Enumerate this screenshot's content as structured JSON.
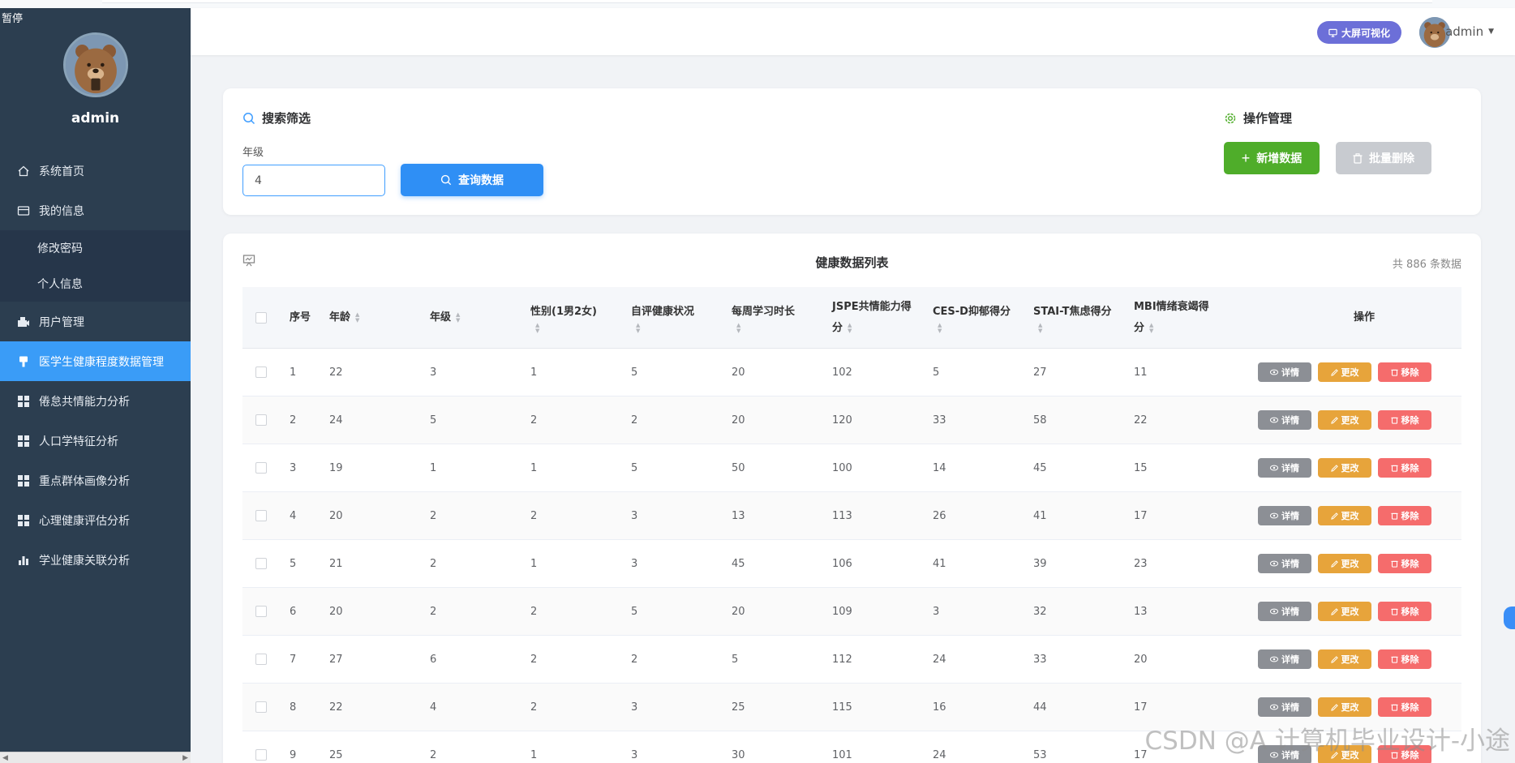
{
  "corner_tag": "暂停",
  "sidebar": {
    "username": "admin",
    "items": [
      {
        "label": "系统首页",
        "icon": "home-icon"
      },
      {
        "label": "我的信息",
        "icon": "card-icon"
      },
      {
        "label": "修改密码",
        "icon": ""
      },
      {
        "label": "个人信息",
        "icon": ""
      },
      {
        "label": "用户管理",
        "icon": "user-manage-icon"
      },
      {
        "label": "医学生健康程度数据管理",
        "icon": "data-manage-icon"
      },
      {
        "label": "倦怠共情能力分析",
        "icon": "grid-icon"
      },
      {
        "label": "人口学特征分析",
        "icon": "grid-icon"
      },
      {
        "label": "重点群体画像分析",
        "icon": "grid-icon"
      },
      {
        "label": "心理健康评估分析",
        "icon": "grid-icon"
      },
      {
        "label": "学业健康关联分析",
        "icon": "bar-chart-icon"
      }
    ]
  },
  "header": {
    "big_screen_label": "大屏可视化",
    "username": "admin"
  },
  "search": {
    "title": "搜索筛选",
    "grade_label": "年级",
    "grade_value": "4",
    "query_label": "查询数据"
  },
  "ops": {
    "title": "操作管理",
    "add_label": "新增数据",
    "batch_delete_label": "批量删除"
  },
  "table": {
    "title": "健康数据列表",
    "count_text": "共 886 条数据",
    "columns": {
      "index": "序号",
      "age": "年龄",
      "grade": "年级",
      "gender": "性别(1男2女)",
      "self_health": "自评健康状况",
      "study_hours": "每周学习时长",
      "jspe_1": "JSPE共情能力得",
      "jspe_2": "分",
      "cesd": "CES-D抑郁得分",
      "stai": "STAI-T焦虑得分",
      "mbi_1": "MBI情绪衰竭得",
      "mbi_2": "分",
      "actions": "操作"
    },
    "action_labels": {
      "detail": "详情",
      "edit": "更改",
      "remove": "移除"
    },
    "rows": [
      {
        "idx": "1",
        "age": "22",
        "grade": "3",
        "gender": "1",
        "health": "5",
        "hours": "20",
        "jspe": "102",
        "cesd": "5",
        "stai": "27",
        "mbi": "11"
      },
      {
        "idx": "2",
        "age": "24",
        "grade": "5",
        "gender": "2",
        "health": "2",
        "hours": "20",
        "jspe": "120",
        "cesd": "33",
        "stai": "58",
        "mbi": "22"
      },
      {
        "idx": "3",
        "age": "19",
        "grade": "1",
        "gender": "1",
        "health": "5",
        "hours": "50",
        "jspe": "100",
        "cesd": "14",
        "stai": "45",
        "mbi": "15"
      },
      {
        "idx": "4",
        "age": "20",
        "grade": "2",
        "gender": "2",
        "health": "3",
        "hours": "13",
        "jspe": "113",
        "cesd": "26",
        "stai": "41",
        "mbi": "17"
      },
      {
        "idx": "5",
        "age": "21",
        "grade": "2",
        "gender": "1",
        "health": "3",
        "hours": "45",
        "jspe": "106",
        "cesd": "41",
        "stai": "39",
        "mbi": "23"
      },
      {
        "idx": "6",
        "age": "20",
        "grade": "2",
        "gender": "2",
        "health": "5",
        "hours": "20",
        "jspe": "109",
        "cesd": "3",
        "stai": "32",
        "mbi": "13"
      },
      {
        "idx": "7",
        "age": "27",
        "grade": "6",
        "gender": "2",
        "health": "2",
        "hours": "5",
        "jspe": "112",
        "cesd": "24",
        "stai": "33",
        "mbi": "20"
      },
      {
        "idx": "8",
        "age": "22",
        "grade": "4",
        "gender": "2",
        "health": "3",
        "hours": "25",
        "jspe": "115",
        "cesd": "16",
        "stai": "44",
        "mbi": "17"
      },
      {
        "idx": "9",
        "age": "25",
        "grade": "2",
        "gender": "1",
        "health": "3",
        "hours": "30",
        "jspe": "101",
        "cesd": "24",
        "stai": "53",
        "mbi": "17"
      }
    ]
  },
  "watermark": "CSDN @A 计算机毕业设计-小途"
}
